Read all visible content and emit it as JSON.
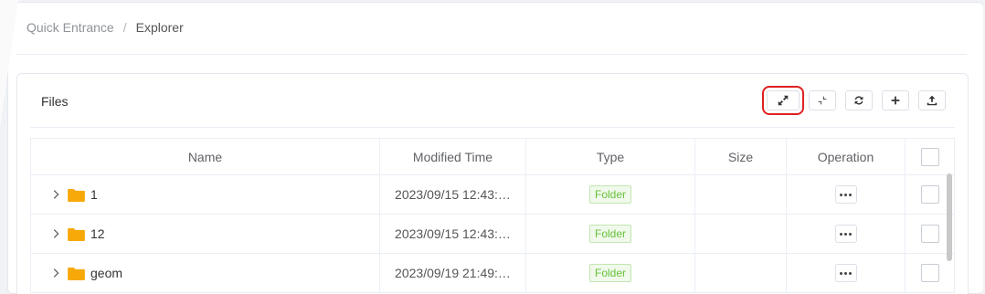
{
  "breadcrumb": {
    "items": [
      "Quick Entrance",
      "Explorer"
    ],
    "separator": "/"
  },
  "card": {
    "title": "Files"
  },
  "toolbar": {
    "buttons": [
      {
        "name": "expand-icon",
        "highlighted": true
      },
      {
        "name": "collapse-icon",
        "highlighted": false
      },
      {
        "name": "refresh-icon",
        "highlighted": false
      },
      {
        "name": "plus-icon",
        "highlighted": false
      },
      {
        "name": "upload-icon",
        "highlighted": false
      }
    ]
  },
  "table": {
    "headers": {
      "name": "Name",
      "modified": "Modified Time",
      "type": "Type",
      "size": "Size",
      "operation": "Operation"
    },
    "rows": [
      {
        "name": "1",
        "modified": "2023/09/15 12:43:…",
        "type": "Folder",
        "size": ""
      },
      {
        "name": "12",
        "modified": "2023/09/15 12:43:…",
        "type": "Folder",
        "size": ""
      },
      {
        "name": "geom",
        "modified": "2023/09/19 21:49:…",
        "type": "Folder",
        "size": ""
      }
    ]
  },
  "colors": {
    "folder": "#f7a90a",
    "tag_text": "#67c23a",
    "highlight": "#e02020"
  }
}
